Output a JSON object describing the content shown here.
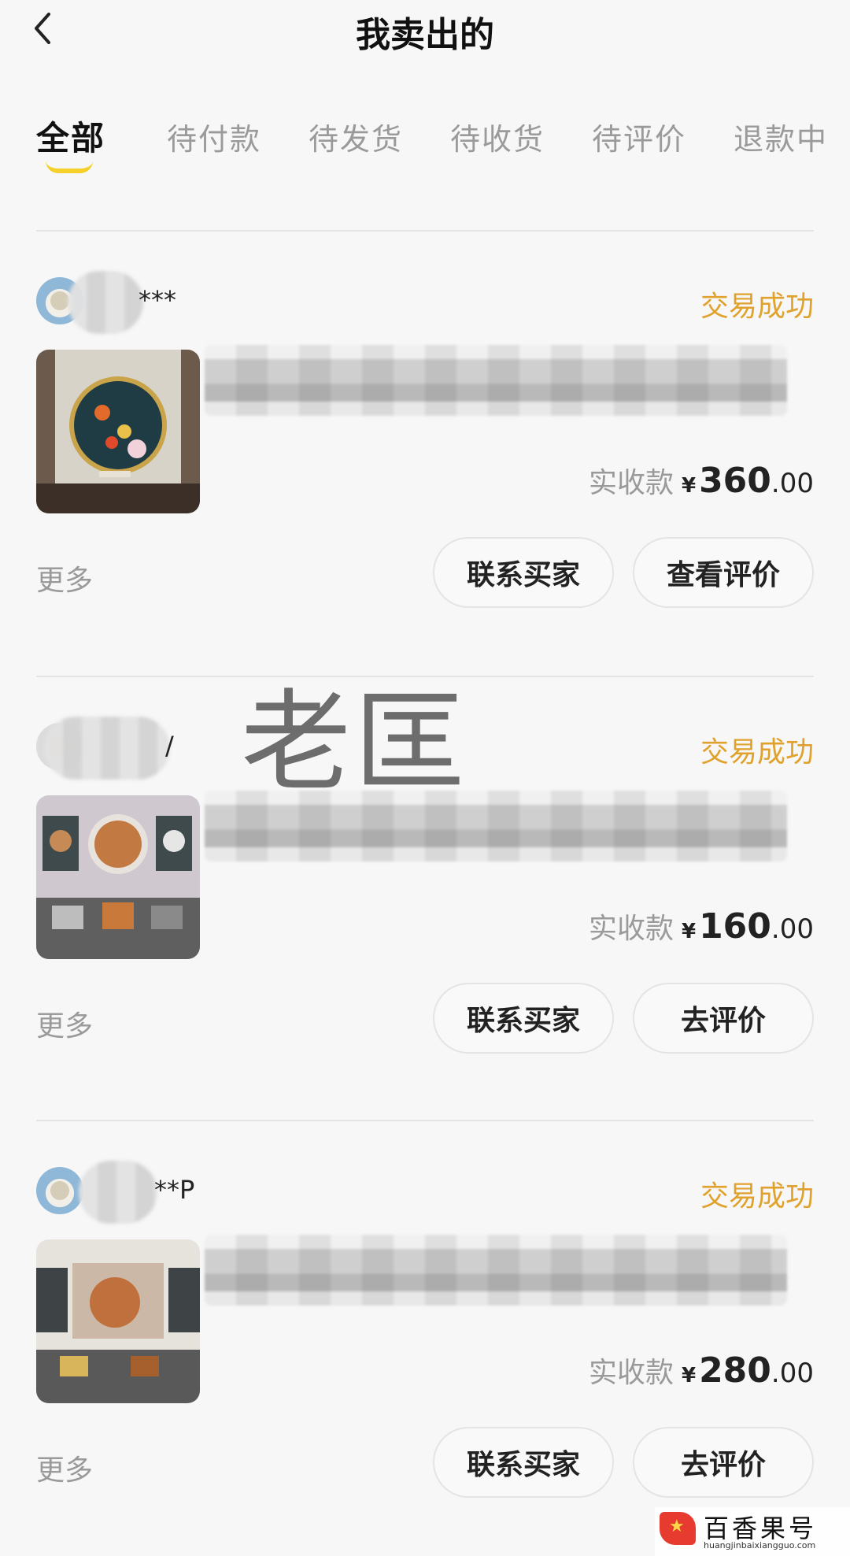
{
  "header": {
    "title": "我卖出的",
    "back_icon": "chevron-left-icon"
  },
  "tabs": [
    {
      "label": "全部",
      "active": true
    },
    {
      "label": "待付款",
      "active": false
    },
    {
      "label": "待发货",
      "active": false
    },
    {
      "label": "待收货",
      "active": false
    },
    {
      "label": "待评价",
      "active": false
    },
    {
      "label": "退款中",
      "active": false
    }
  ],
  "orders": [
    {
      "buyer": "***",
      "status": "交易成功",
      "price_label": "实收款",
      "currency": "¥",
      "price_int": "360",
      "price_dec": ".00",
      "more": "更多",
      "btn_contact": "联系买家",
      "btn_review": "查看评价"
    },
    {
      "buyer": "/",
      "status": "交易成功",
      "price_label": "实收款",
      "currency": "¥",
      "price_int": "160",
      "price_dec": ".00",
      "more": "更多",
      "btn_contact": "联系买家",
      "btn_review": "去评价"
    },
    {
      "buyer": "**P",
      "status": "交易成功",
      "price_label": "实收款",
      "currency": "¥",
      "price_int": "280",
      "price_dec": ".00",
      "more": "更多",
      "btn_contact": "联系买家",
      "btn_review": "去评价"
    }
  ],
  "overlay_text": "老匡",
  "watermark": {
    "name": "百香果号",
    "url": "huangjinbaixiangguo.com"
  },
  "colors": {
    "status": "#e0a22c",
    "tab_underline": "#f5d02a",
    "background": "#f7f7f7"
  }
}
